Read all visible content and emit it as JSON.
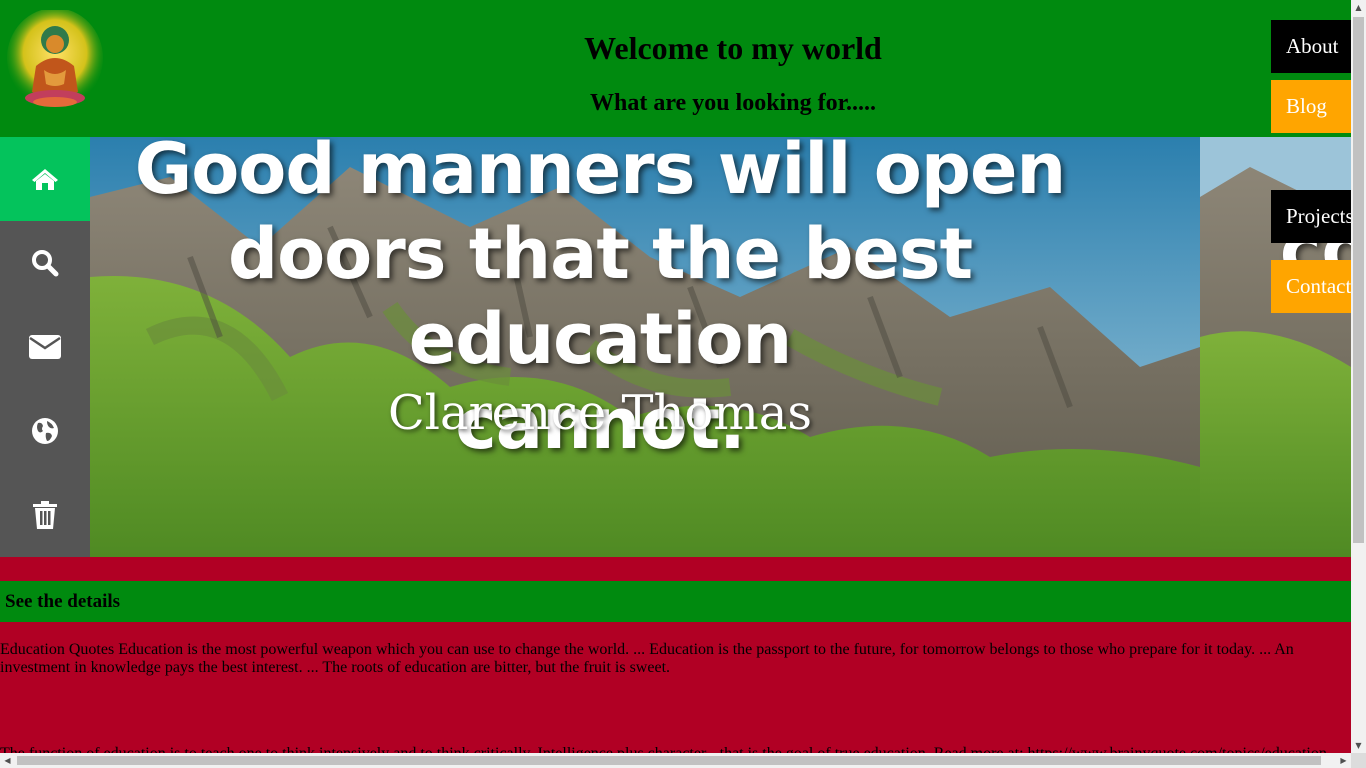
{
  "header": {
    "title": "Welcome to my world",
    "subtitle": "What are you looking for....."
  },
  "nav": {
    "about": "About",
    "blog": "Blog",
    "projects": "Projects",
    "contact": "Contact"
  },
  "sidebar": {
    "items": [
      {
        "icon": "home-icon",
        "active": true
      },
      {
        "icon": "search-icon",
        "active": false
      },
      {
        "icon": "envelope-icon",
        "active": false
      },
      {
        "icon": "globe-icon",
        "active": false
      },
      {
        "icon": "trash-icon",
        "active": false
      }
    ]
  },
  "hero": {
    "quote_line1": "Good manners will open",
    "quote_line2": "doors that the best education",
    "quote_line3": "cannot.",
    "author": "Clarence Thomas",
    "next_slide_text": "co"
  },
  "details": {
    "heading": "See the details",
    "paragraph1": "Education Quotes Education is the most powerful weapon which you can use to change the world. ... Education is the passport to the future, for tomorrow belongs to those who prepare for it today. ... An investment in knowledge pays the best interest. ... The roots of education are bitter, but the fruit is sweet.",
    "paragraph2": "The function of education is to teach one to think intensively and to think critically. Intelligence plus character - that is the goal of true education. Read more at: https://www.brainyquote.com/topics/education"
  },
  "colors": {
    "header_bg": "#008a0f",
    "body_bg": "#b10024",
    "sidebar_bg": "#555555",
    "sidebar_active": "#04c35c",
    "nav_orange": "#ffa500",
    "nav_black": "#000000"
  }
}
